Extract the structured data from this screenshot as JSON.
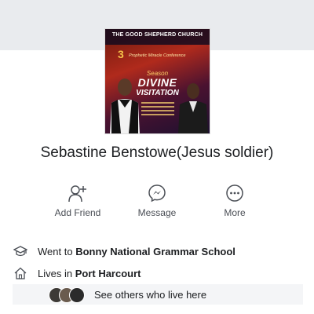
{
  "cover": {
    "title": "THE GOOD SHEPHERD CHURCH",
    "number": "3",
    "conference": "Prophetic Miracle Conference",
    "season": "Season",
    "divine": "DIVINE",
    "visitation": "VISITATION"
  },
  "profile": {
    "name": "Sebastine Benstowe(Jesus soldier)"
  },
  "actions": {
    "add_friend": "Add Friend",
    "message": "Message",
    "more": "More"
  },
  "info": {
    "education_prefix": "Went to ",
    "education_value": "Bonny National Grammar School",
    "home_prefix": "Lives in ",
    "home_value": "Port Harcourt",
    "see_others": "See others who live here"
  },
  "colors": {
    "icon": "#4b4f56",
    "background_band": "#e9ebee"
  }
}
